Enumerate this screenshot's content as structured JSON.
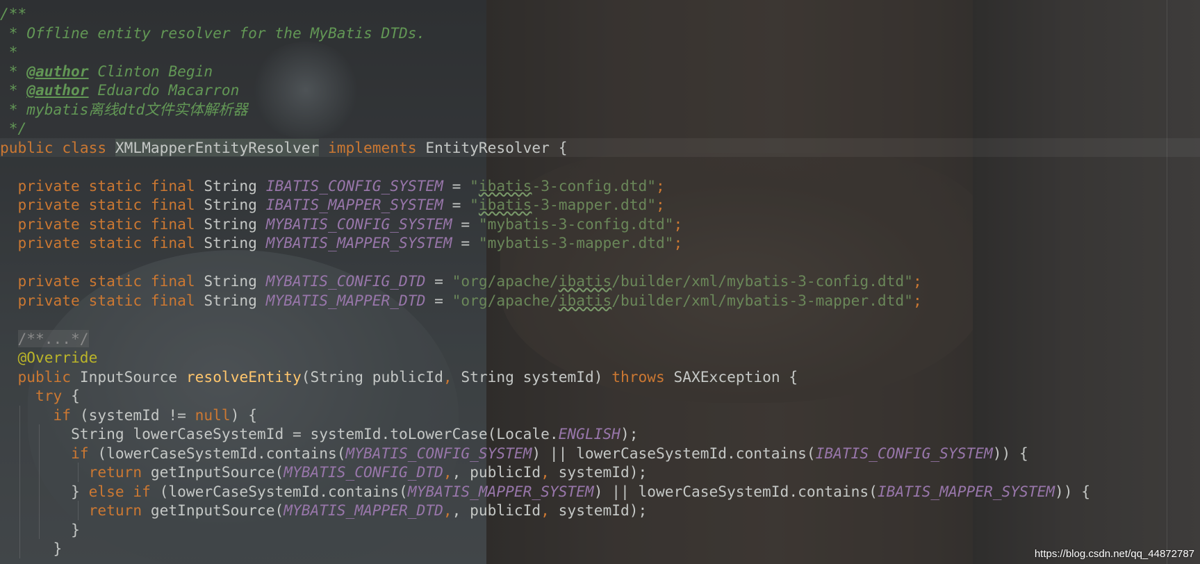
{
  "code": {
    "javadoc_open": "/**",
    "javadoc_line1": " * Offline entity resolver for the MyBatis DTDs.",
    "javadoc_blank": " *",
    "javadoc_star": " * ",
    "author_tag": "@author",
    "author1": " Clinton Begin",
    "author2": " Eduardo Macarron",
    "javadoc_line_cn": " * mybatis离线dtd文件实体解析器",
    "javadoc_close": " */",
    "class_decl": {
      "mod1": "public",
      "mod2": "class",
      "name": "XMLMapperEntityResolver",
      "impl": "implements",
      "iface": "EntityResolver",
      "brace": " {"
    },
    "field_mods": "private static final",
    "field_type": "String",
    "fields": [
      {
        "name": "IBATIS_CONFIG_SYSTEM",
        "q1": "\"",
        "typo": "ibatis",
        "rest": "-3-config.dtd\""
      },
      {
        "name": "IBATIS_MAPPER_SYSTEM",
        "q1": "\"",
        "typo": "ibatis",
        "rest": "-3-mapper.dtd\""
      },
      {
        "name": "MYBATIS_CONFIG_SYSTEM",
        "value": "\"mybatis-3-config.dtd\""
      },
      {
        "name": "MYBATIS_MAPPER_SYSTEM",
        "value": "\"mybatis-3-mapper.dtd\""
      },
      {
        "name": "MYBATIS_CONFIG_DTD",
        "pre": "\"org/apache/",
        "typo": "ibatis",
        "post": "/builder/xml/mybatis-3-config.dtd\""
      },
      {
        "name": "MYBATIS_MAPPER_DTD",
        "pre": "\"org/apache/",
        "typo": "ibatis",
        "post": "/builder/xml/mybatis-3-mapper.dtd\""
      }
    ],
    "folded_doc": "/**...*/",
    "override": "@Override",
    "method": {
      "mod": "public",
      "ret": "InputSource",
      "name": "resolveEntity",
      "params": "(String publicId",
      "params2": " String systemId) ",
      "throws": "throws",
      "exc": " SAXException {"
    },
    "try_kw": "try",
    "try_brace": " {",
    "if_kw": "if",
    "if_cond": " (systemId != ",
    "null_kw": "null",
    "if_end": ") {",
    "lower_decl": "String lowerCaseSystemId = systemId.toLowerCase(Locale.",
    "locale_const": "ENGLISH",
    "lower_end": ");",
    "cond1_a": " (lowerCaseSystemId.contains(",
    "cond1_c1": "MYBATIS_CONFIG_SYSTEM",
    "cond1_b": ") || lowerCaseSystemId.contains(",
    "cond1_c2": "IBATIS_CONFIG_SYSTEM",
    "cond1_end": ")) {",
    "return_kw": "return",
    "ret1_a": " getInputSource(",
    "ret1_c": "MYBATIS_CONFIG_DTD",
    "ret_args": ", publicId",
    "ret_args2": " systemId);",
    "else_open": "} ",
    "else_kw": "else if",
    "cond2_a": " (lowerCaseSystemId.contains(",
    "cond2_c1": "MYBATIS_MAPPER_SYSTEM",
    "cond2_b": ") || lowerCaseSystemId.contains(",
    "cond2_c2": "IBATIS_MAPPER_SYSTEM",
    "cond2_end": ")) {",
    "ret2_c": "MYBATIS_MAPPER_DTD",
    "close_brace": "}",
    "eq": " = ",
    "semi": ";",
    "comma": ","
  },
  "watermark": "https://blog.csdn.net/qq_44872787"
}
